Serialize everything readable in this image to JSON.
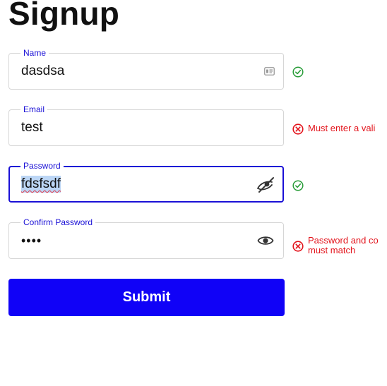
{
  "title": "Signup",
  "colors": {
    "accent": "#1a10d6",
    "button": "#1002f7",
    "success": "#2a9d3a",
    "error": "#e3141c"
  },
  "fields": [
    {
      "label": "Name",
      "value": "dasdsa",
      "trailing_icon": "contact-card-icon",
      "status": "valid",
      "status_icon": "check-circle-icon",
      "message": ""
    },
    {
      "label": "Email",
      "value": "test",
      "trailing_icon": "",
      "status": "invalid",
      "status_icon": "x-circle-icon",
      "message": "Must enter a vali"
    },
    {
      "label": "Password",
      "value": "fdsfsdf",
      "trailing_icon": "eye-slash-icon",
      "status": "valid",
      "status_icon": "check-circle-icon",
      "message": "",
      "focused": true
    },
    {
      "label": "Confirm Password",
      "value": "••••",
      "trailing_icon": "eye-icon",
      "status": "invalid",
      "status_icon": "x-circle-icon",
      "message": "Password and co\nmust match"
    }
  ],
  "submit_label": "Submit"
}
